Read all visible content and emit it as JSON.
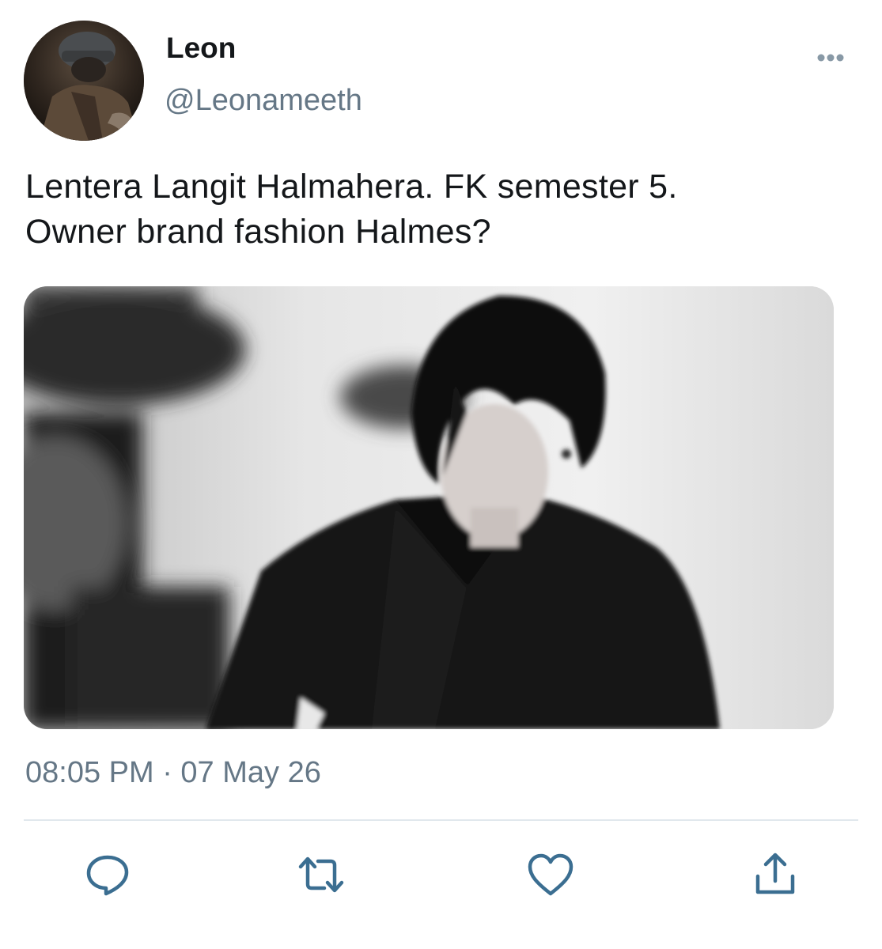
{
  "tweet": {
    "display_name": "Leon",
    "handle": "@Leonameeth",
    "text_line1": "Lentera Langit Halmahera. FK semester 5.",
    "text_line2": "Owner brand fashion Halmes?",
    "timestamp": "08:05 PM · 07 May 26"
  },
  "icons": {
    "more": "more-horizontal-icon",
    "reply": "reply-icon",
    "retweet": "retweet-icon",
    "like": "heart-icon",
    "share": "share-icon"
  },
  "colors": {
    "text_primary": "#14171a",
    "text_secondary": "#657786",
    "icon": "#3b6e91",
    "divider": "#e1e8ed"
  }
}
